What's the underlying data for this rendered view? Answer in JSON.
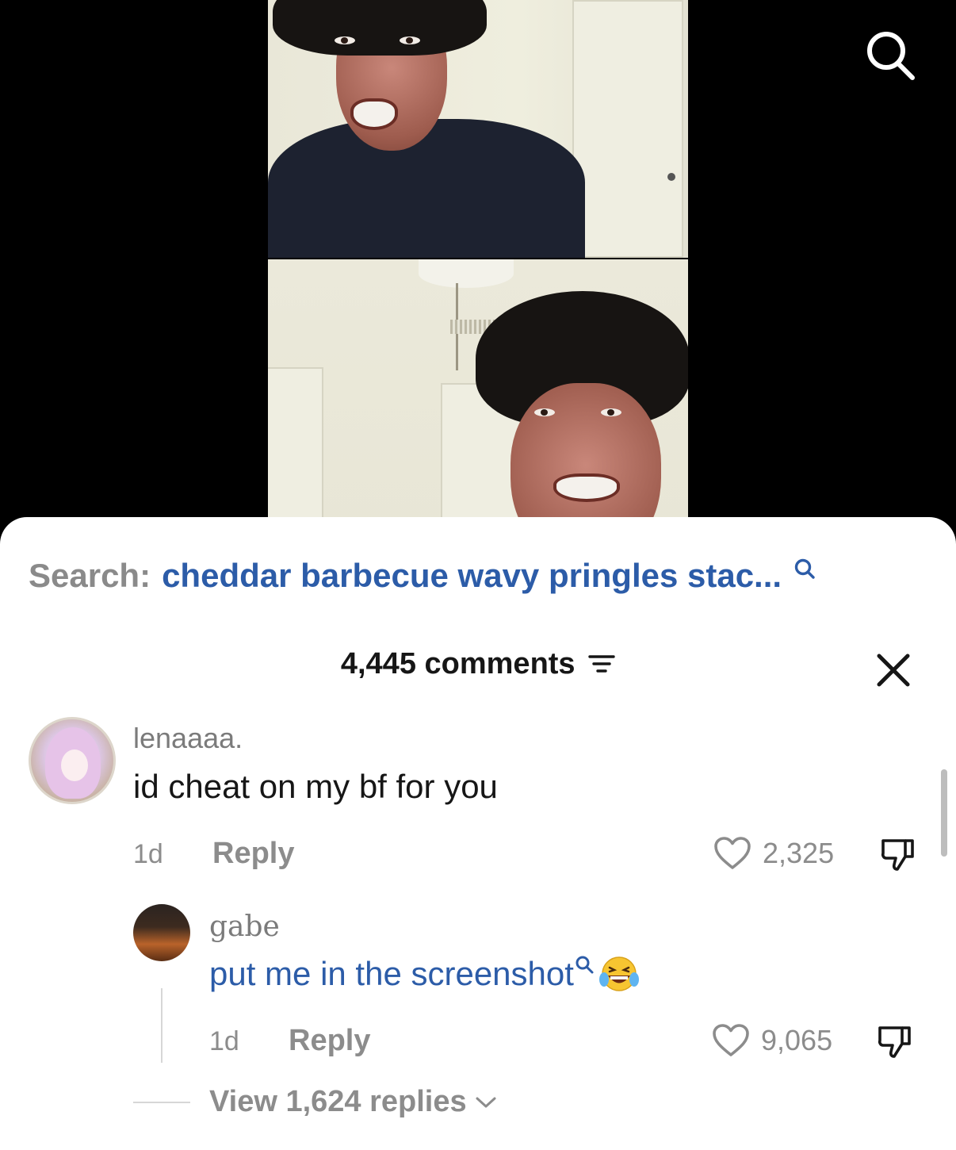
{
  "search_bar": {
    "prefix": "Search:",
    "query": "cheddar barbecue wavy pringles stac..."
  },
  "comments_header": {
    "count_label": "4,445 comments"
  },
  "comments": [
    {
      "username": "lenaaaa.",
      "text": "id cheat on my bf for you",
      "time": "1d",
      "reply_label": "Reply",
      "likes": "2,325"
    }
  ],
  "replies": [
    {
      "username": "gabe",
      "text": "put me in the screenshot",
      "time": "1d",
      "reply_label": "Reply",
      "likes": "9,065"
    }
  ],
  "view_replies_label": "View 1,624 replies",
  "colors": {
    "link_blue": "#2c5ca8",
    "muted_gray": "#8c8c8c",
    "text_dark": "#161616"
  },
  "icons": [
    "search-icon",
    "filter-icon",
    "close-icon",
    "heart-icon",
    "dislike-icon",
    "chevron-down-icon",
    "laughing-emoji-icon"
  ]
}
